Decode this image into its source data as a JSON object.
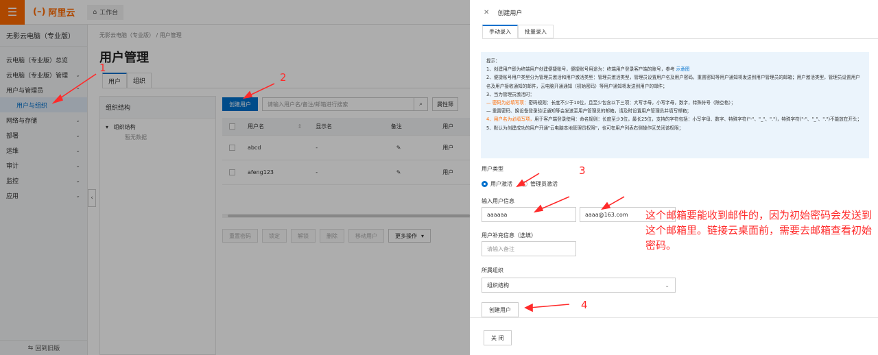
{
  "topbar": {
    "logo": "阿里云",
    "workbench": "工作台"
  },
  "sidebar": {
    "title": "无影云电脑（专业版）",
    "items": [
      {
        "label": "云电脑（专业版）总览",
        "chevron": false
      },
      {
        "label": "云电脑（专业版）管理",
        "chevron": true
      },
      {
        "label": "用户与管理员",
        "chevron": true
      },
      {
        "label": "用户与组织",
        "chevron": false
      },
      {
        "label": "网络与存储",
        "chevron": true
      },
      {
        "label": "部署",
        "chevron": true
      },
      {
        "label": "运维",
        "chevron": true
      },
      {
        "label": "审计",
        "chevron": true
      },
      {
        "label": "监控",
        "chevron": true
      },
      {
        "label": "应用",
        "chevron": true
      }
    ],
    "back_link": "回到旧版"
  },
  "main": {
    "breadcrumb": "无影云电脑（专业版） / 用户管理",
    "title": "用户管理",
    "tabs": [
      "用户",
      "组织"
    ],
    "org_panel": {
      "title": "组织结构",
      "node": "组织结构",
      "empty": "暂无数据"
    },
    "toolbar": {
      "create_button": "创建用户",
      "search_placeholder": "请输入用户名/备注/邮箱进行搜索",
      "attr_button": "属性筛"
    },
    "table": {
      "columns": [
        "用户名",
        "显示名",
        "备注",
        "用户"
      ],
      "rows": [
        {
          "username": "abcd",
          "display": "-",
          "more": "用户"
        },
        {
          "username": "afeng123",
          "display": "-",
          "more": "用户"
        }
      ]
    },
    "bulk_actions": [
      "重置密码",
      "锁定",
      "解锁",
      "删除",
      "移动用户",
      "更多操作"
    ]
  },
  "drawer": {
    "title": "创建用户",
    "tabs": [
      "手动录入",
      "批量录入"
    ],
    "tips": {
      "heading": "提示：",
      "line1": "1、创建用户即为终端用户创建便捷账号，便捷账号用途为：终端用户登录客户端的账号，参考",
      "line1_link": "示意图",
      "line2": "2、便捷账号用户类型分为管理员激活和用户激活类型：管理员激活类型，管理员设置用户名及用户密码，重置密码等用户通知将发送到用户管理员的邮箱；用户激活类型，管理员设置用户名及用户接收通知的邮件，云电脑开通通知（初始密码）等用户通知将发送到用户的邮件；",
      "line3": "3、当为管理员激活时：",
      "line4_hl": "— 密码为必填写项：",
      "line4": "密码规则：长度不少于10位，且至少包含以下三项：大写字母，小写字母，数字，特殊符号（除空格）；",
      "line5": "— 重置密码、换设备登录验证通知等会发送至用户管理员的邮箱，请及时设置用户管理员并填写邮箱；",
      "line6_hl": "4、用户名为必填写项，",
      "line6": "用于客户端登录使用：命名规则：长度至少3位，最长25位，支持的字符包括：小写字母、数字、特殊字符(\"-\"、\"_\"、\".\")，特殊字符(\"-\"、\"_\"、\".\")不能放在开头；",
      "line7": "5、默认为创建成功的用户开通\"云电脑本地管理员权限\"，也可在用户列表右侧操作区关闭该权限；"
    },
    "user_type_label": "用户类型",
    "user_type_options": [
      "用户激活",
      "管理员激活"
    ],
    "user_type_selected": "用户激活",
    "user_info_label": "输入用户信息",
    "username_value": "aaaaaa",
    "email_value": "aaaa@163.com",
    "extra_label": "用户补充信息（选填）",
    "remark_placeholder": "请输入备注",
    "org_label": "所属组织",
    "org_value": "组织结构",
    "create_button": "创建用户",
    "close_button": "关 闭"
  },
  "annotations": {
    "numbers": [
      "1",
      "2",
      "3",
      "4"
    ],
    "note": "这个邮箱要能收到邮件的，因为初始密码会发送到这个邮箱里。链接云桌面前，需要去邮箱查看初始密码。",
    "color": "#ff2a2a"
  },
  "colors": {
    "brand": "#ff6a00",
    "primary": "#0070cc",
    "annotation": "#ff2a2a"
  }
}
